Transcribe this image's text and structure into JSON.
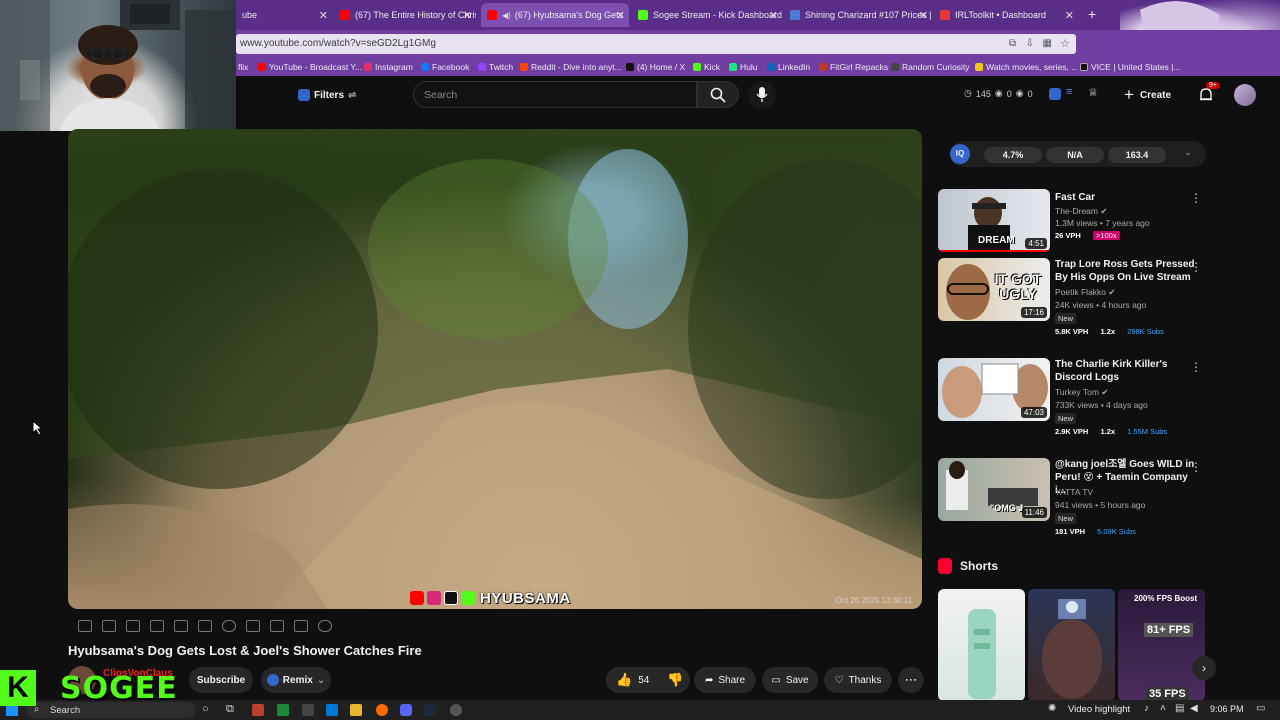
{
  "browser": {
    "tabs": [
      {
        "label": "ube",
        "color": "#e53935"
      },
      {
        "label": "(67) The Entire History of Chris",
        "color": "#ff0000"
      },
      {
        "label": "(67) Hyubsama's Dog Gets",
        "color": "#ff0000"
      },
      {
        "label": "Sogee Stream - Kick Dashboard",
        "color": "#53fc18"
      },
      {
        "label": "Shining Charizard #107 Prices |",
        "color": "#4a7bd8"
      },
      {
        "label": "IRLToolkit • Dashboard",
        "color": "#e53935"
      }
    ],
    "new_tab": "+",
    "url": "www.youtube.com/watch?v=seGD2Lg1GMg",
    "bookmarks": [
      {
        "label": "flix",
        "color": "#e50914"
      },
      {
        "label": "YouTube - Broadcast Y...",
        "color": "#ff0000"
      },
      {
        "label": "Instagram",
        "color": "#e1306c"
      },
      {
        "label": "Facebook",
        "color": "#1877f2"
      },
      {
        "label": "Twitch",
        "color": "#9146ff"
      },
      {
        "label": "Reddit - Dive into anyt...",
        "color": "#ff4500"
      },
      {
        "label": "(4) Home / X",
        "color": "#000000"
      },
      {
        "label": "Kick",
        "color": "#53fc18"
      },
      {
        "label": "Hulu",
        "color": "#1ce783"
      },
      {
        "label": "LinkedIn",
        "color": "#0a66c2"
      },
      {
        "label": "FitGirl Repacks",
        "color": "#c0392b"
      },
      {
        "label": "Random Curiosity",
        "color": "#444444"
      },
      {
        "label": "Watch movies, series, ...",
        "color": "#f5c518"
      },
      {
        "label": "VICE | United States |...",
        "color": "#000000"
      }
    ]
  },
  "youtube": {
    "filters_label": "Filters",
    "search_placeholder": "Search",
    "counts": {
      "a": "145",
      "b": "0",
      "c": "0"
    },
    "create_label": "Create",
    "notif_badge": "9+",
    "video": {
      "overlay_name": "HYUBSAMA",
      "timestamp": "Oct 26 2025 13:30:11",
      "title": "Hyubsama's Dog Gets Lost & Joel's Shower Catches Fire",
      "channel": "ClipsVonClaus",
      "subscribe": "Subscribe",
      "remix": "Remix",
      "likes": "54",
      "share": "Share",
      "save": "Save",
      "thanks": "Thanks"
    },
    "stats": {
      "s1": "4.7%",
      "s2": "N/A",
      "s3": "163.4",
      "logo": "IQ"
    },
    "recommendations": [
      {
        "title": "Fast Car",
        "channel": "The-Dream",
        "meta": "1.3M views • 7 years ago",
        "duration": "4:51",
        "vph": "26 VPH",
        "ratio": ">100x",
        "subs": "",
        "new": false
      },
      {
        "title": "Trap Lore Ross Gets Pressed By His Opps On Live Stream",
        "channel": "Poetik Flakko",
        "meta": "24K views • 4 hours ago",
        "duration": "17:16",
        "vph": "5.8K VPH",
        "ratio": "1.2x",
        "subs": "298K Subs",
        "new": true
      },
      {
        "title": "The Charlie Kirk Killer's Discord Logs",
        "channel": "Turkey Tom",
        "meta": "733K views • 4 days ago",
        "duration": "47:03",
        "vph": "2.9K VPH",
        "ratio": "1.2x",
        "subs": "1.55M Subs",
        "new": true
      },
      {
        "title": "@kang joel조엘 Goes WILD in Peru! 😵 + Taemin Company i...",
        "channel": "YATTA TV",
        "meta": "941 views • 5 hours ago",
        "duration": "11:46",
        "vph": "181 VPH",
        "ratio": "",
        "subs": "5.09K Subs",
        "new": true
      }
    ],
    "thumb_text": {
      "t1": "DREAM",
      "t2": "IT GOT UGLY",
      "t4": "\"OMG J"
    },
    "new_label": "New",
    "shorts_label": "Shorts",
    "shorts": [
      {
        "label": ""
      },
      {
        "label": ""
      },
      {
        "label": "200% FPS Boost",
        "fps1": "81+ FPS",
        "fps2": "35 FPS"
      }
    ]
  },
  "overlay": {
    "brand": "SOGEE",
    "brand_k": "K"
  },
  "taskbar": {
    "search": "Search",
    "highlight": "Video highlight",
    "time": "9:06 PM"
  }
}
